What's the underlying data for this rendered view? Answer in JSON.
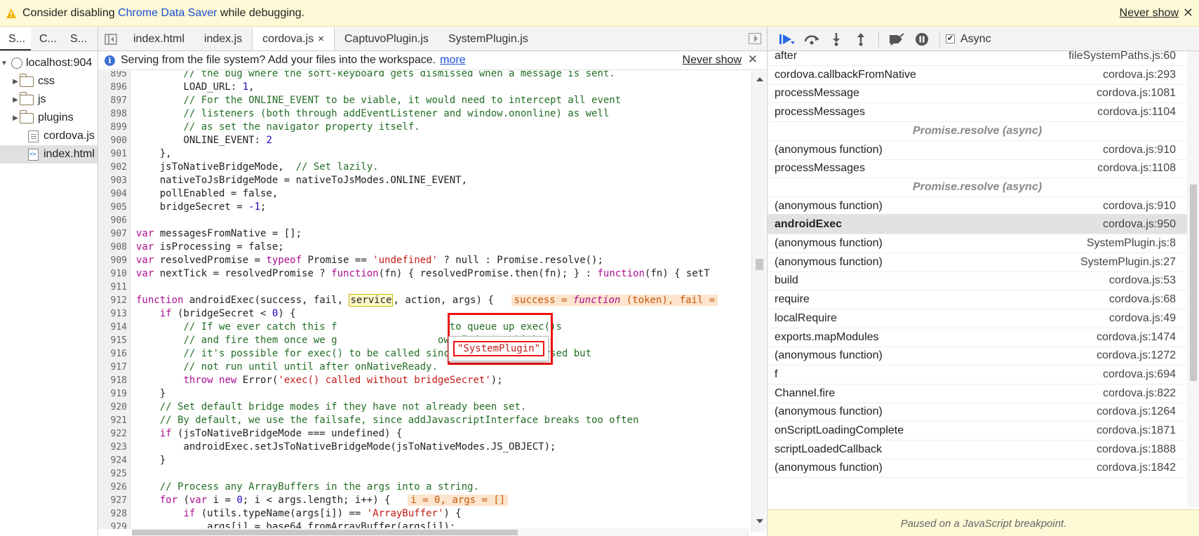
{
  "warning_bar": {
    "prefix": "Consider disabling ",
    "link": "Chrome Data Saver",
    "suffix": " while debugging.",
    "never_show": "Never show",
    "close": "✕"
  },
  "navigator": {
    "tabs": [
      "S...",
      "C...",
      "S..."
    ],
    "tree": [
      {
        "label": "localhost:904",
        "kind": "origin",
        "level": 0,
        "expanded": true
      },
      {
        "label": "css",
        "kind": "folder",
        "level": 1
      },
      {
        "label": "js",
        "kind": "folder",
        "level": 1
      },
      {
        "label": "plugins",
        "kind": "folder",
        "level": 1
      },
      {
        "label": "cordova.js",
        "kind": "file-js",
        "level": 1
      },
      {
        "label": "index.html",
        "kind": "file-html",
        "level": 1,
        "selected": true
      }
    ]
  },
  "editor": {
    "tabs": [
      {
        "label": "index.html",
        "active": false
      },
      {
        "label": "index.js",
        "active": false
      },
      {
        "label": "cordova.js",
        "active": true
      },
      {
        "label": "CaptuvoPlugin.js",
        "active": false
      },
      {
        "label": "SystemPlugin.js",
        "active": false
      }
    ],
    "tab_close": "×",
    "infobar": {
      "text": "Serving from the file system? Add your files into the workspace.",
      "more": "more",
      "never_show": "Never show",
      "close": "✕"
    },
    "lines": [
      {
        "n": "895",
        "t": "        // the bug where the soft-keyboard gets dismissed when a message is sent."
      },
      {
        "n": "896",
        "t": "        LOAD_URL: 1,"
      },
      {
        "n": "897",
        "t": "        // For the ONLINE_EVENT to be viable, it would need to intercept all event"
      },
      {
        "n": "898",
        "t": "        // listeners (both through addEventListener and window.ononline) as well"
      },
      {
        "n": "899",
        "t": "        // as set the navigator property itself."
      },
      {
        "n": "900",
        "t": "        ONLINE_EVENT: 2"
      },
      {
        "n": "901",
        "t": "    },"
      },
      {
        "n": "902",
        "t": "    jsToNativeBridgeMode,  // Set lazily."
      },
      {
        "n": "903",
        "t": "    nativeToJsBridgeMode = nativeToJsModes.ONLINE_EVENT,"
      },
      {
        "n": "904",
        "t": "    pollEnabled = false,"
      },
      {
        "n": "905",
        "t": "    bridgeSecret = -1;"
      },
      {
        "n": "906",
        "t": ""
      },
      {
        "n": "907",
        "t": "var messagesFromNative = [];"
      },
      {
        "n": "908",
        "t": "var isProcessing = false;"
      },
      {
        "n": "909",
        "t": "var resolvedPromise = typeof Promise == 'undefined' ? null : Promise.resolve();"
      },
      {
        "n": "910",
        "t": "var nextTick = resolvedPromise ? function(fn) { resolvedPromise.then(fn); } : function(fn) { setT"
      },
      {
        "n": "911",
        "t": ""
      },
      {
        "n": "912",
        "t": "function androidExec(success, fail, service, action, args) {"
      },
      {
        "n": "913",
        "t": "    if (bridgeSecret < 0) {"
      },
      {
        "n": "914",
        "t": "        // If we ever catch this f                   to queue up exec()s"
      },
      {
        "n": "915",
        "t": "        // and fire them once we g                 ow, I don't think"
      },
      {
        "n": "916",
        "t": "        // it's possible for exec() to be called since plugins are parsed but"
      },
      {
        "n": "917",
        "t": "        // not run until until after onNativeReady."
      },
      {
        "n": "918",
        "t": "        throw new Error('exec() called without bridgeSecret');"
      },
      {
        "n": "919",
        "t": "    }"
      },
      {
        "n": "920",
        "t": "    // Set default bridge modes if they have not already been set."
      },
      {
        "n": "921",
        "t": "    // By default, we use the failsafe, since addJavascriptInterface breaks too often"
      },
      {
        "n": "922",
        "t": "    if (jsToNativeBridgeMode === undefined) {"
      },
      {
        "n": "923",
        "t": "        androidExec.setJsToNativeBridgeMode(jsToNativeModes.JS_OBJECT);"
      },
      {
        "n": "924",
        "t": "    }"
      },
      {
        "n": "925",
        "t": ""
      },
      {
        "n": "926",
        "t": "    // Process any ArrayBuffers in the args into a string."
      },
      {
        "n": "927",
        "t": "    for (var i = 0; i < args.length; i++) {"
      },
      {
        "n": "928",
        "t": "        if (utils.typeName(args[i]) == 'ArrayBuffer') {"
      },
      {
        "n": "929",
        "t": "            args[i] = base64.fromArrayBuffer(args[i]);"
      }
    ],
    "inline_values": {
      "line_912": "success = function (token), fail =",
      "line_927": "i = 0, args = []"
    },
    "tooltip_value": "\"SystemPlugin\""
  },
  "debugger": {
    "async_label": "Async",
    "async_checked": true,
    "call_stack": [
      {
        "fn": "after",
        "loc": "fileSystemPaths.js:60"
      },
      {
        "fn": "cordova.callbackFromNative",
        "loc": "cordova.js:293"
      },
      {
        "fn": "processMessage",
        "loc": "cordova.js:1081"
      },
      {
        "fn": "processMessages",
        "loc": "cordova.js:1104"
      },
      {
        "fn": "Promise.resolve (async)",
        "loc": "",
        "async": true
      },
      {
        "fn": "(anonymous function)",
        "loc": "cordova.js:910"
      },
      {
        "fn": "processMessages",
        "loc": "cordova.js:1108"
      },
      {
        "fn": "Promise.resolve (async)",
        "loc": "",
        "async": true
      },
      {
        "fn": "(anonymous function)",
        "loc": "cordova.js:910"
      },
      {
        "fn": "androidExec",
        "loc": "cordova.js:950",
        "selected": true
      },
      {
        "fn": "(anonymous function)",
        "loc": "SystemPlugin.js:8"
      },
      {
        "fn": "(anonymous function)",
        "loc": "SystemPlugin.js:27"
      },
      {
        "fn": "build",
        "loc": "cordova.js:53"
      },
      {
        "fn": "require",
        "loc": "cordova.js:68"
      },
      {
        "fn": "localRequire",
        "loc": "cordova.js:49"
      },
      {
        "fn": "exports.mapModules",
        "loc": "cordova.js:1474"
      },
      {
        "fn": "(anonymous function)",
        "loc": "cordova.js:1272"
      },
      {
        "fn": "f",
        "loc": "cordova.js:694"
      },
      {
        "fn": "Channel.fire",
        "loc": "cordova.js:822"
      },
      {
        "fn": "(anonymous function)",
        "loc": "cordova.js:1264"
      },
      {
        "fn": "onScriptLoadingComplete",
        "loc": "cordova.js:1871"
      },
      {
        "fn": "scriptLoadedCallback",
        "loc": "cordova.js:1888"
      },
      {
        "fn": "(anonymous function)",
        "loc": "cordova.js:1842"
      }
    ],
    "paused_message": "Paused on a JavaScript breakpoint."
  },
  "colors": {
    "warning_bg": "#fef9d6",
    "link": "#1a4fd6",
    "comment": "#236e25",
    "keyword": "#aa0d91",
    "string": "#c41a16",
    "highlight_border": "#ee1111",
    "active_step_icon": "#2a6ae0"
  }
}
